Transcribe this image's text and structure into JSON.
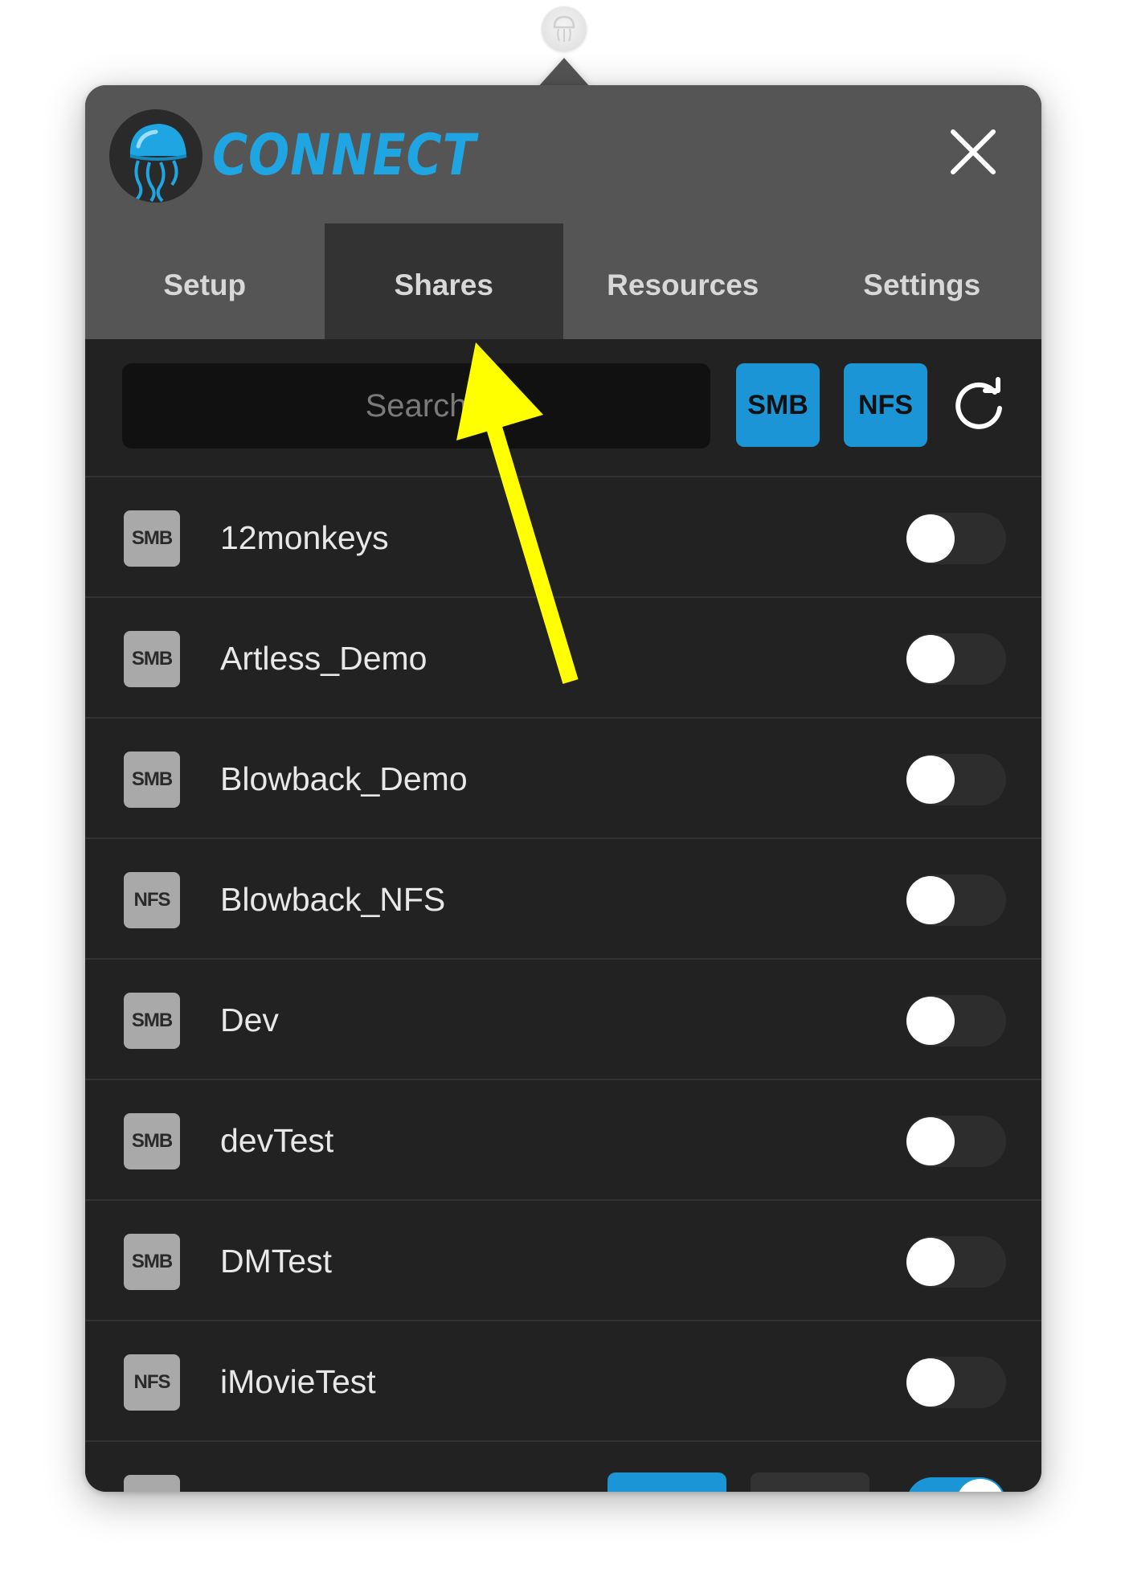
{
  "app": {
    "title": "CONNECT",
    "accent_color": "#1fa6e2",
    "logo_icon": "jellyfish-logo-icon",
    "close_icon": "close-icon"
  },
  "tabs": [
    {
      "label": "Setup",
      "active": false
    },
    {
      "label": "Shares",
      "active": true
    },
    {
      "label": "Resources",
      "active": false
    },
    {
      "label": "Settings",
      "active": false
    }
  ],
  "toolbar": {
    "search_placeholder": "Search",
    "filters": [
      {
        "label": "SMB",
        "active": true
      },
      {
        "label": "NFS",
        "active": true
      }
    ],
    "refresh_icon": "refresh-icon"
  },
  "shares": [
    {
      "type": "SMB",
      "name": "12monkeys",
      "mounted": false
    },
    {
      "type": "SMB",
      "name": "Artless_Demo",
      "mounted": false
    },
    {
      "type": "SMB",
      "name": "Blowback_Demo",
      "mounted": false
    },
    {
      "type": "NFS",
      "name": "Blowback_NFS",
      "mounted": false
    },
    {
      "type": "SMB",
      "name": "Dev",
      "mounted": false
    },
    {
      "type": "SMB",
      "name": "devTest",
      "mounted": false
    },
    {
      "type": "SMB",
      "name": "DMTest",
      "mounted": false
    },
    {
      "type": "NFS",
      "name": "iMovieTest",
      "mounted": false
    },
    {
      "type": "SMB",
      "name": "",
      "mounted": true,
      "partial": true
    }
  ],
  "annotation": {
    "icon": "arrow-icon",
    "color": "#ffff00",
    "points_to": "tab-shares"
  },
  "colors": {
    "header_bg": "#555555",
    "active_tab_bg": "#333333",
    "body_bg": "#222222",
    "filter_btn": "#1b95d6",
    "badge_bg": "#a9a9a9"
  }
}
